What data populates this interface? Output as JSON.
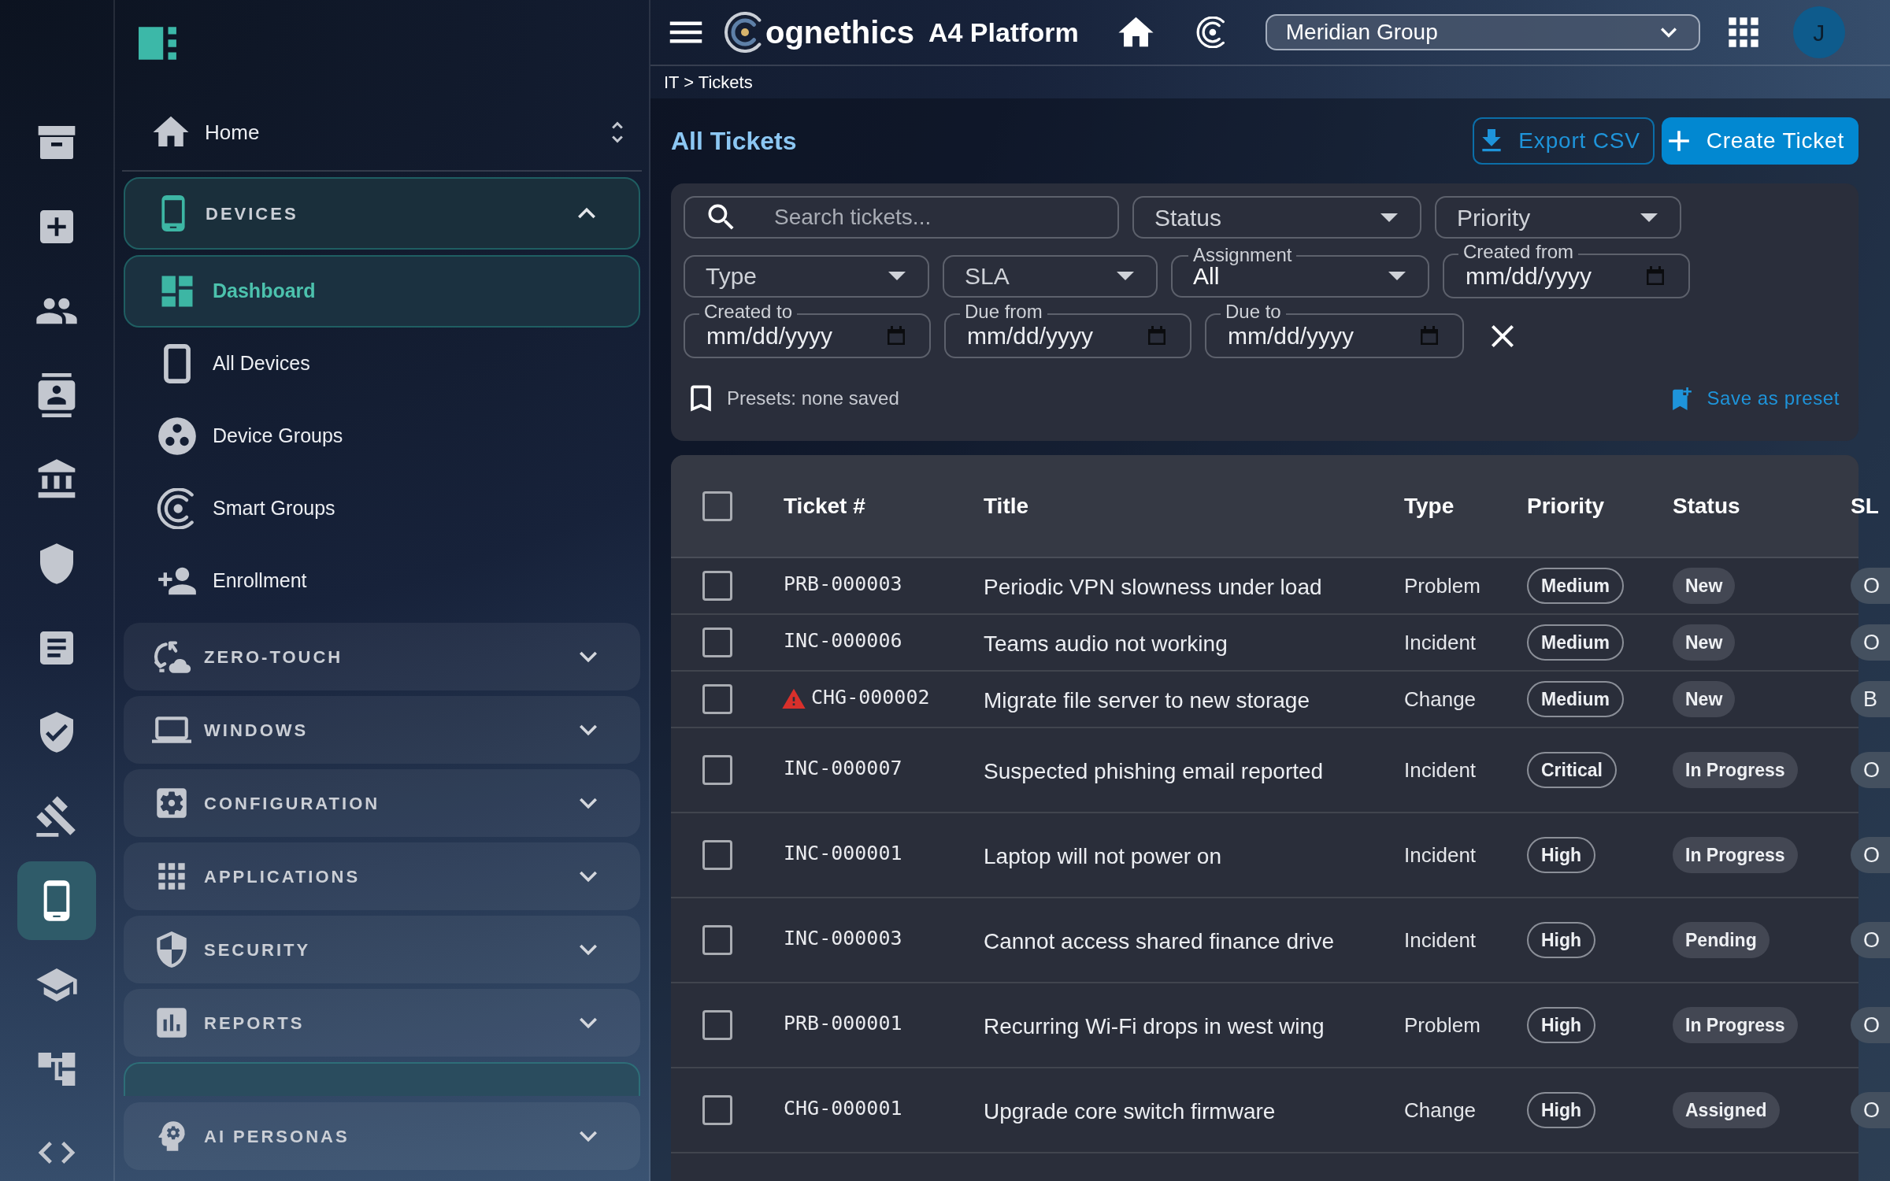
{
  "rail": {
    "items": [
      {
        "selected": false
      },
      {
        "selected": false
      },
      {
        "selected": false
      },
      {
        "selected": false
      },
      {
        "selected": false
      },
      {
        "selected": false
      },
      {
        "selected": false
      },
      {
        "selected": false
      },
      {
        "selected": false
      },
      {
        "selected": true
      },
      {
        "selected": false
      },
      {
        "selected": false
      }
    ]
  },
  "sidebar": {
    "home": {
      "label": "Home"
    },
    "groups": [
      {
        "label": "DEVICES",
        "expanded": true,
        "children": [
          {
            "label": "Dashboard",
            "selected": true
          },
          {
            "label": "All Devices",
            "selected": false
          },
          {
            "label": "Device Groups",
            "selected": false
          },
          {
            "label": "Smart Groups",
            "selected": false
          },
          {
            "label": "Enrollment",
            "selected": false
          }
        ]
      },
      {
        "label": "ZERO-TOUCH",
        "expanded": false
      },
      {
        "label": "WINDOWS",
        "expanded": false
      },
      {
        "label": "CONFIGURATION",
        "expanded": false
      },
      {
        "label": "APPLICATIONS",
        "expanded": false
      },
      {
        "label": "SECURITY",
        "expanded": false
      },
      {
        "label": "REPORTS",
        "expanded": false
      }
    ],
    "footer_group": {
      "label": "AI PERSONAS",
      "expanded": false
    }
  },
  "topbar": {
    "brand": "ognethics",
    "product": "A4 Platform",
    "organization": "Meridian Group",
    "avatar": "J"
  },
  "breadcrumb": "IT > Tickets",
  "page": {
    "title": "All Tickets",
    "actions": [
      {
        "label": "Export CSV",
        "kind": "outlined"
      },
      {
        "label": "Create Ticket",
        "kind": "contained"
      }
    ]
  },
  "filters": {
    "fields": [
      {
        "kind": "search",
        "placeholder": "Search tickets..."
      },
      {
        "kind": "select",
        "label": "Status"
      },
      {
        "kind": "select",
        "label": "Priority"
      },
      {
        "kind": "select",
        "label": "Type"
      },
      {
        "kind": "select",
        "label": "SLA"
      },
      {
        "kind": "select",
        "label": "Assignment",
        "value": "All"
      },
      {
        "kind": "date",
        "label": "Created from",
        "placeholder": "mm/dd/yyyy"
      },
      {
        "kind": "date",
        "label": "Created to",
        "placeholder": "mm/dd/yyyy"
      },
      {
        "kind": "date",
        "label": "Due from",
        "placeholder": "mm/dd/yyyy"
      },
      {
        "kind": "date",
        "label": "Due to",
        "placeholder": "mm/dd/yyyy"
      }
    ],
    "presets": "Presets: none saved",
    "save_preset": "Save as preset"
  },
  "table": {
    "select_all": {
      "checked": false
    },
    "columns": [
      "Ticket #",
      "Title",
      "Type",
      "Priority",
      "Status",
      "SL"
    ],
    "rows": [
      {
        "checked": false,
        "warning": false,
        "ticket": "PRB-000003",
        "title": "Periodic VPN slowness under load",
        "type": "Problem",
        "priority": "Medium",
        "status": "New",
        "sla": "O"
      },
      {
        "checked": false,
        "warning": false,
        "ticket": "INC-000006",
        "title": "Teams audio not working",
        "type": "Incident",
        "priority": "Medium",
        "status": "New",
        "sla": "O"
      },
      {
        "checked": false,
        "warning": true,
        "ticket": "CHG-000002",
        "title": "Migrate file server to new storage",
        "type": "Change",
        "priority": "Medium",
        "status": "New",
        "sla": "B"
      },
      {
        "checked": false,
        "warning": false,
        "ticket": "INC-000007",
        "title": "Suspected phishing email reported",
        "type": "Incident",
        "priority": "Critical",
        "status": "In Progress",
        "sla": "O"
      },
      {
        "checked": false,
        "warning": false,
        "ticket": "INC-000001",
        "title": "Laptop will not power on",
        "type": "Incident",
        "priority": "High",
        "status": "In Progress",
        "sla": "O"
      },
      {
        "checked": false,
        "warning": false,
        "ticket": "INC-000003",
        "title": "Cannot access shared finance drive",
        "type": "Incident",
        "priority": "High",
        "status": "Pending",
        "sla": "O"
      },
      {
        "checked": false,
        "warning": false,
        "ticket": "PRB-000001",
        "title": "Recurring Wi-Fi drops in west wing",
        "type": "Problem",
        "priority": "High",
        "status": "In Progress",
        "sla": "O"
      },
      {
        "checked": false,
        "warning": false,
        "ticket": "CHG-000001",
        "title": "Upgrade core switch firmware",
        "type": "Change",
        "priority": "High",
        "status": "Assigned",
        "sla": "O"
      }
    ]
  }
}
